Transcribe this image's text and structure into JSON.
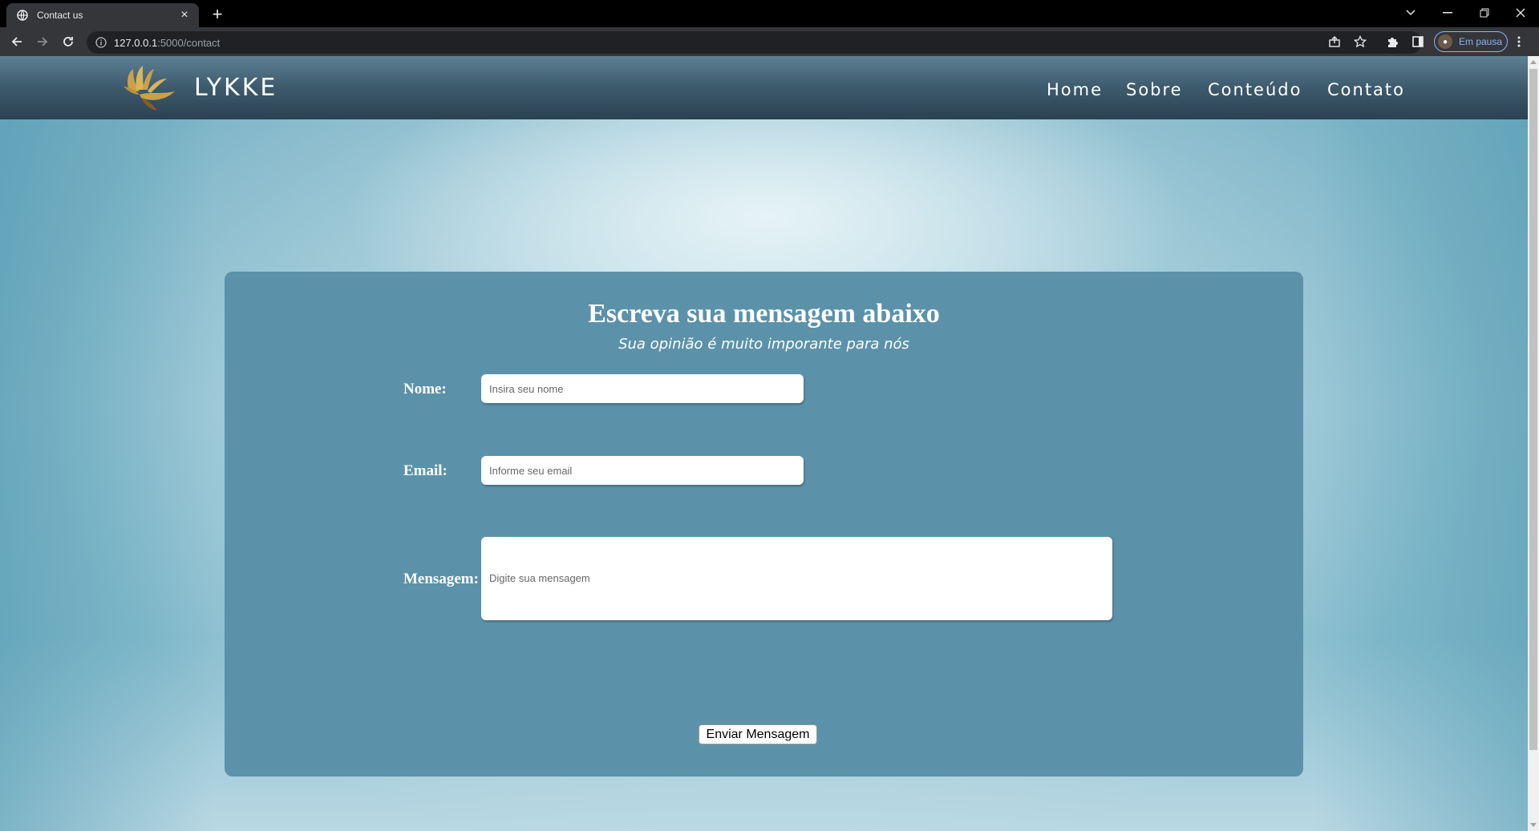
{
  "browser": {
    "tab_title": "Contact us",
    "url_host": "127.0.0.1",
    "url_rest": ":5000/contact",
    "profile_label": "Em pausa"
  },
  "site": {
    "brand": "LYKKE",
    "nav": [
      "Home",
      "Sobre",
      "Conteúdo",
      "Contato"
    ]
  },
  "form": {
    "title": "Escreva sua mensagem abaixo",
    "subtitle": "Sua opinião é muito imporante para nós",
    "name_label": "Nome:",
    "name_placeholder": "Insira seu nome",
    "email_label": "Email:",
    "email_placeholder": "Informe seu email",
    "message_label": "Mensagem:",
    "message_placeholder": "Digite sua mensagem",
    "submit_label": "Enviar Mensagem"
  },
  "colors": {
    "header_dark": "#2a4252",
    "card": "#5b92aa",
    "logo_gold": "#c9a14a",
    "logo_brown": "#8a5a2b"
  }
}
